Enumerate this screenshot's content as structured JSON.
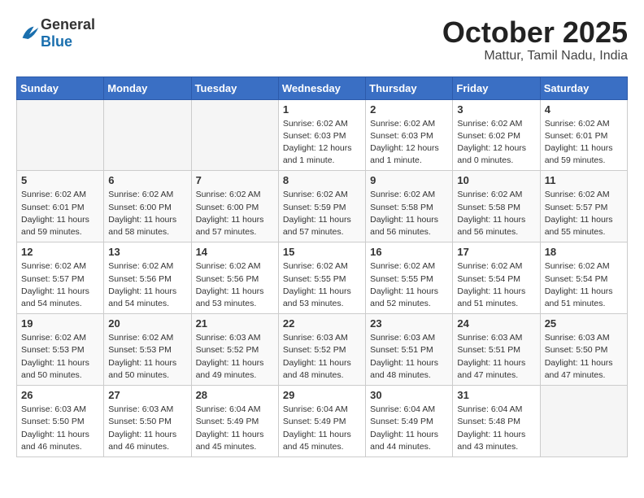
{
  "header": {
    "logo_general": "General",
    "logo_blue": "Blue",
    "month_title": "October 2025",
    "location": "Mattur, Tamil Nadu, India"
  },
  "days_of_week": [
    "Sunday",
    "Monday",
    "Tuesday",
    "Wednesday",
    "Thursday",
    "Friday",
    "Saturday"
  ],
  "weeks": [
    [
      {
        "day": "",
        "info": ""
      },
      {
        "day": "",
        "info": ""
      },
      {
        "day": "",
        "info": ""
      },
      {
        "day": "1",
        "info": "Sunrise: 6:02 AM\nSunset: 6:03 PM\nDaylight: 12 hours and 1 minute."
      },
      {
        "day": "2",
        "info": "Sunrise: 6:02 AM\nSunset: 6:03 PM\nDaylight: 12 hours and 1 minute."
      },
      {
        "day": "3",
        "info": "Sunrise: 6:02 AM\nSunset: 6:02 PM\nDaylight: 12 hours and 0 minutes."
      },
      {
        "day": "4",
        "info": "Sunrise: 6:02 AM\nSunset: 6:01 PM\nDaylight: 11 hours and 59 minutes."
      }
    ],
    [
      {
        "day": "5",
        "info": "Sunrise: 6:02 AM\nSunset: 6:01 PM\nDaylight: 11 hours and 59 minutes."
      },
      {
        "day": "6",
        "info": "Sunrise: 6:02 AM\nSunset: 6:00 PM\nDaylight: 11 hours and 58 minutes."
      },
      {
        "day": "7",
        "info": "Sunrise: 6:02 AM\nSunset: 6:00 PM\nDaylight: 11 hours and 57 minutes."
      },
      {
        "day": "8",
        "info": "Sunrise: 6:02 AM\nSunset: 5:59 PM\nDaylight: 11 hours and 57 minutes."
      },
      {
        "day": "9",
        "info": "Sunrise: 6:02 AM\nSunset: 5:58 PM\nDaylight: 11 hours and 56 minutes."
      },
      {
        "day": "10",
        "info": "Sunrise: 6:02 AM\nSunset: 5:58 PM\nDaylight: 11 hours and 56 minutes."
      },
      {
        "day": "11",
        "info": "Sunrise: 6:02 AM\nSunset: 5:57 PM\nDaylight: 11 hours and 55 minutes."
      }
    ],
    [
      {
        "day": "12",
        "info": "Sunrise: 6:02 AM\nSunset: 5:57 PM\nDaylight: 11 hours and 54 minutes."
      },
      {
        "day": "13",
        "info": "Sunrise: 6:02 AM\nSunset: 5:56 PM\nDaylight: 11 hours and 54 minutes."
      },
      {
        "day": "14",
        "info": "Sunrise: 6:02 AM\nSunset: 5:56 PM\nDaylight: 11 hours and 53 minutes."
      },
      {
        "day": "15",
        "info": "Sunrise: 6:02 AM\nSunset: 5:55 PM\nDaylight: 11 hours and 53 minutes."
      },
      {
        "day": "16",
        "info": "Sunrise: 6:02 AM\nSunset: 5:55 PM\nDaylight: 11 hours and 52 minutes."
      },
      {
        "day": "17",
        "info": "Sunrise: 6:02 AM\nSunset: 5:54 PM\nDaylight: 11 hours and 51 minutes."
      },
      {
        "day": "18",
        "info": "Sunrise: 6:02 AM\nSunset: 5:54 PM\nDaylight: 11 hours and 51 minutes."
      }
    ],
    [
      {
        "day": "19",
        "info": "Sunrise: 6:02 AM\nSunset: 5:53 PM\nDaylight: 11 hours and 50 minutes."
      },
      {
        "day": "20",
        "info": "Sunrise: 6:02 AM\nSunset: 5:53 PM\nDaylight: 11 hours and 50 minutes."
      },
      {
        "day": "21",
        "info": "Sunrise: 6:03 AM\nSunset: 5:52 PM\nDaylight: 11 hours and 49 minutes."
      },
      {
        "day": "22",
        "info": "Sunrise: 6:03 AM\nSunset: 5:52 PM\nDaylight: 11 hours and 48 minutes."
      },
      {
        "day": "23",
        "info": "Sunrise: 6:03 AM\nSunset: 5:51 PM\nDaylight: 11 hours and 48 minutes."
      },
      {
        "day": "24",
        "info": "Sunrise: 6:03 AM\nSunset: 5:51 PM\nDaylight: 11 hours and 47 minutes."
      },
      {
        "day": "25",
        "info": "Sunrise: 6:03 AM\nSunset: 5:50 PM\nDaylight: 11 hours and 47 minutes."
      }
    ],
    [
      {
        "day": "26",
        "info": "Sunrise: 6:03 AM\nSunset: 5:50 PM\nDaylight: 11 hours and 46 minutes."
      },
      {
        "day": "27",
        "info": "Sunrise: 6:03 AM\nSunset: 5:50 PM\nDaylight: 11 hours and 46 minutes."
      },
      {
        "day": "28",
        "info": "Sunrise: 6:04 AM\nSunset: 5:49 PM\nDaylight: 11 hours and 45 minutes."
      },
      {
        "day": "29",
        "info": "Sunrise: 6:04 AM\nSunset: 5:49 PM\nDaylight: 11 hours and 45 minutes."
      },
      {
        "day": "30",
        "info": "Sunrise: 6:04 AM\nSunset: 5:49 PM\nDaylight: 11 hours and 44 minutes."
      },
      {
        "day": "31",
        "info": "Sunrise: 6:04 AM\nSunset: 5:48 PM\nDaylight: 11 hours and 43 minutes."
      },
      {
        "day": "",
        "info": ""
      }
    ]
  ]
}
